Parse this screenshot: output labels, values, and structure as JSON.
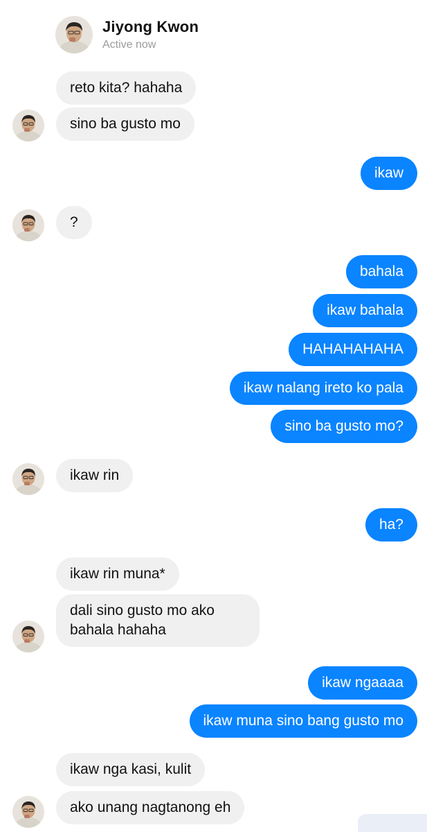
{
  "header": {
    "name": "Jiyong Kwon",
    "status": "Active now"
  },
  "messages": [
    {
      "side": "in",
      "text": "reto kita? hahaha"
    },
    {
      "side": "in",
      "text": "sino ba gusto mo"
    },
    {
      "side": "out",
      "text": "ikaw"
    },
    {
      "side": "in",
      "text": "?"
    },
    {
      "side": "out",
      "text": "bahala"
    },
    {
      "side": "out",
      "text": "ikaw bahala"
    },
    {
      "side": "out",
      "text": "HAHAHAHAHA"
    },
    {
      "side": "out",
      "text": "ikaw nalang ireto ko pala"
    },
    {
      "side": "out",
      "text": "sino ba gusto mo?"
    },
    {
      "side": "in",
      "text": "ikaw rin"
    },
    {
      "side": "out",
      "text": "ha?"
    },
    {
      "side": "in",
      "text": "ikaw rin muna*"
    },
    {
      "side": "in",
      "lines": [
        "dali sino gusto mo ako",
        "bahala hahaha"
      ]
    },
    {
      "side": "out",
      "text": "ikaw ngaaaa"
    },
    {
      "side": "out",
      "text": "ikaw muna sino bang gusto mo"
    },
    {
      "side": "in",
      "text": "ikaw nga kasi, kulit"
    },
    {
      "side": "in",
      "text": "ako unang nagtanong eh"
    }
  ],
  "colors": {
    "outgoing": "#0a84ff",
    "incoming": "#f0f0f0",
    "status": "#9a9a9a"
  },
  "icons": {
    "avatar": "contact-avatar-photo"
  }
}
